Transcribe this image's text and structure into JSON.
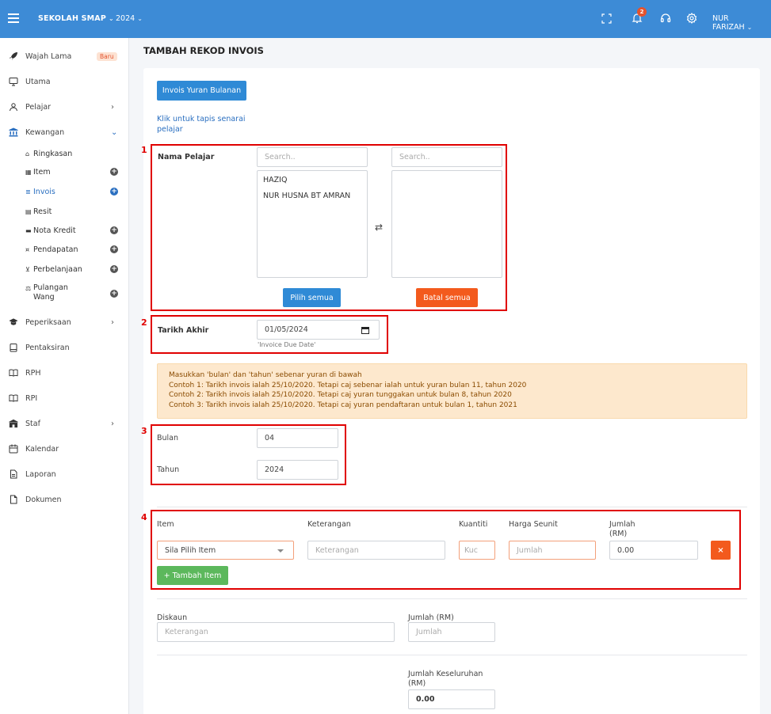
{
  "topbar": {
    "school": "SEKOLAH SMAP",
    "year": "2024",
    "notifications_count": "2",
    "user": "NUR FARIZAH",
    "chevron": "⌄",
    "icons": [
      "menu-icon",
      "fullscreen-icon",
      "bell-icon",
      "support-icon",
      "gear-icon"
    ]
  },
  "sidebar": {
    "items": [
      {
        "label": "Wajah Lama",
        "icon": "rocket-icon",
        "badge": "Baru"
      },
      {
        "label": "Utama",
        "icon": "monitor-icon"
      },
      {
        "label": "Pelajar",
        "icon": "user-icon",
        "arrow": "›"
      },
      {
        "label": "Kewangan",
        "icon": "bank-icon",
        "arrow": "⌄"
      },
      {
        "label": "Peperiksaan",
        "icon": "graduation-icon",
        "arrow": "›"
      },
      {
        "label": "Pentaksiran",
        "icon": "clipboard-icon"
      },
      {
        "label": "RPH",
        "icon": "book-icon"
      },
      {
        "label": "RPI",
        "icon": "book-icon"
      },
      {
        "label": "Staf",
        "icon": "staff-icon",
        "arrow": "›"
      },
      {
        "label": "Kalendar",
        "icon": "calendar-icon"
      },
      {
        "label": "Laporan",
        "icon": "report-icon"
      },
      {
        "label": "Dokumen",
        "icon": "document-icon"
      }
    ],
    "sub_items": [
      {
        "label": "Ringkasan",
        "glyph": "⌂"
      },
      {
        "label": "Item",
        "glyph": "▦",
        "plus": "+"
      },
      {
        "label": "Invois",
        "glyph": "≣",
        "plus": "+"
      },
      {
        "label": "Resit",
        "glyph": "▤"
      },
      {
        "label": "Nota Kredit",
        "glyph": "▬",
        "plus": "+"
      },
      {
        "label": "Pendapatan",
        "glyph": "¤",
        "plus": "+"
      },
      {
        "label": "Perbelanjaan",
        "glyph": "⊻",
        "plus": "+"
      },
      {
        "label": "Pulangan",
        "label2": "Wang",
        "glyph": "⚖",
        "plus": "+"
      }
    ]
  },
  "page": {
    "title": "TAMBAH REKOD INVOIS",
    "invoice_button": "Invois Yuran Bulanan",
    "filter_link_line1": "Klik untuk tapis senarai",
    "filter_link_line2": "pelajar"
  },
  "annotations": [
    "1",
    "2",
    "3",
    "4"
  ],
  "students": {
    "label": "Nama Pelajar",
    "search_placeholder_left": "Search..",
    "search_placeholder_right": "Search..",
    "options": [
      "HAZIQ",
      "NUR HUSNA BT AMRAN"
    ],
    "transfer_glyph": "⇄",
    "select_all": "Pilih semua",
    "deselect_all": "Batal semua"
  },
  "due_date": {
    "label": "Tarikh Akhir",
    "value": "01/05/2024",
    "hint": "'Invoice Due Date'"
  },
  "notice": {
    "lines": [
      "Masukkan 'bulan' dan 'tahun' sebenar yuran di bawah",
      "Contoh 1: Tarikh invois ialah 25/10/2020. Tetapi caj sebenar ialah untuk yuran bulan 11, tahun 2020",
      "Contoh 2: Tarikh invois ialah 25/10/2020. Tetapi caj yuran tunggakan untuk bulan 8, tahun 2020",
      "Contoh 3: Tarikh invois ialah 25/10/2020. Tetapi caj yuran pendaftaran untuk bulan 1, tahun 2021"
    ]
  },
  "period": {
    "month_label": "Bulan",
    "month_value": "04",
    "year_label": "Tahun",
    "year_value": "2024"
  },
  "items_table": {
    "headers": {
      "item": "Item",
      "description": "Keterangan",
      "quantity": "Kuantiti",
      "unit_price": "Harga Seunit",
      "amount_line1": "Jumlah",
      "amount_line2": "(RM)"
    },
    "row": {
      "item_select": "Sila Pilih Item",
      "description_placeholder": "Keterangan",
      "quantity_placeholder": "Kuc",
      "unit_price_placeholder": "Jumlah",
      "amount": "0.00",
      "delete": "×"
    },
    "add_button": "+ Tambah Item"
  },
  "discount": {
    "label": "Diskaun",
    "placeholder": "Keterangan",
    "amount_label": "Jumlah (RM)",
    "amount_placeholder": "Jumlah"
  },
  "total": {
    "label_line1": "Jumlah Keseluruhan",
    "label_line2": "(RM)",
    "value": "0.00"
  }
}
